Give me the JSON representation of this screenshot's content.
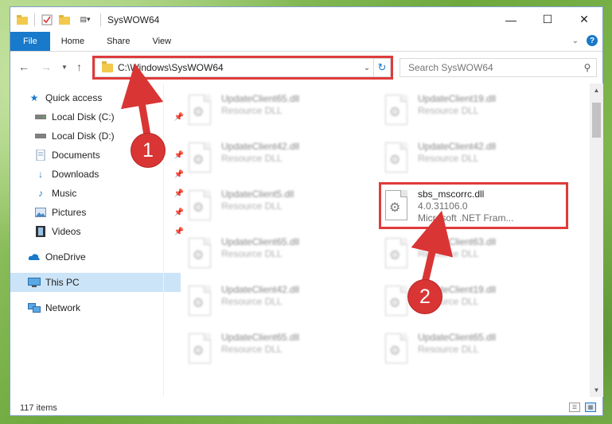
{
  "window": {
    "title": "SysWOW64",
    "controls": {
      "minimize": "—",
      "maximize": "☐",
      "close": "✕"
    }
  },
  "ribbon": {
    "tabs": [
      "File",
      "Home",
      "Share",
      "View"
    ],
    "help_label": "?"
  },
  "address_bar": {
    "path": "C:\\Windows\\SysWOW64",
    "search_placeholder": "Search SysWOW64"
  },
  "sidebar": {
    "items": [
      {
        "label": "Quick access",
        "icon": "star-icon"
      },
      {
        "label": "Local Disk (C:)",
        "icon": "drive-icon"
      },
      {
        "label": "Local Disk (D:)",
        "icon": "drive-icon"
      },
      {
        "label": "Documents",
        "icon": "documents-icon"
      },
      {
        "label": "Downloads",
        "icon": "download-icon"
      },
      {
        "label": "Music",
        "icon": "music-icon"
      },
      {
        "label": "Pictures",
        "icon": "pictures-icon"
      },
      {
        "label": "Videos",
        "icon": "videos-icon"
      },
      {
        "label": "OneDrive",
        "icon": "cloud-icon"
      },
      {
        "label": "This PC",
        "icon": "computer-icon"
      },
      {
        "label": "Network",
        "icon": "network-icon"
      }
    ]
  },
  "files": {
    "left": [
      {
        "name": "UpdateClient65.dll",
        "desc": "Resource DLL"
      },
      {
        "name": "UpdateClient42.dll",
        "desc": "Resource DLL"
      },
      {
        "name": "UpdateClient5.dll",
        "desc": "Resource DLL"
      },
      {
        "name": "UpdateClient65.dll",
        "desc": "Resource DLL"
      },
      {
        "name": "UpdateClient42.dll",
        "desc": "Resource DLL"
      },
      {
        "name": "UpdateClient65.dll",
        "desc": "Resource DLL"
      }
    ],
    "right": [
      {
        "name": "UpdateClient19.dll",
        "desc": "Resource DLL"
      },
      {
        "name": "UpdateClient42.dll",
        "desc": "Resource DLL"
      },
      {
        "name": "sbs_mscorrc.dll",
        "version": "4.0.31106.0",
        "desc": "Microsoft .NET Fram..."
      },
      {
        "name": "UpdateClient63.dll",
        "desc": "Resource DLL"
      },
      {
        "name": "UpdateClient19.dll",
        "desc": "Resource DLL"
      },
      {
        "name": "UpdateClient65.dll",
        "desc": "Resource DLL"
      }
    ]
  },
  "status": {
    "item_count": "117 items"
  },
  "annotations": {
    "step1": "1",
    "step2": "2",
    "color": "#e03b3b"
  }
}
